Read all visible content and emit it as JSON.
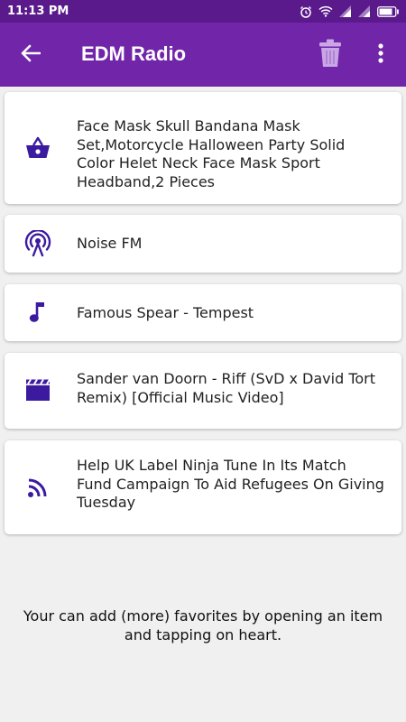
{
  "status_bar": {
    "time": "11:13 PM",
    "icons": [
      "alarm-icon",
      "wifi-icon",
      "signal-icon",
      "signal-icon",
      "battery-icon"
    ]
  },
  "app_bar": {
    "title": "EDM Radio",
    "back_icon": "arrow-left-icon",
    "trash_icon": "trash-icon",
    "menu_icon": "more-vert-icon"
  },
  "colors": {
    "status_bar": "#5a1a8c",
    "app_bar": "#7125a9",
    "icon_accent": "#3b1aa0",
    "background": "#f0f0f0"
  },
  "favorites": [
    {
      "icon": "shopping-basket-icon",
      "label": "Face Mask Skull Bandana Mask Set,Motorcycle Halloween Party Solid Color Helet Neck Face Mask Sport Headband,2 Pieces"
    },
    {
      "icon": "radio-tower-icon",
      "label": "Noise FM"
    },
    {
      "icon": "music-note-icon",
      "label": "Famous Spear - Tempest"
    },
    {
      "icon": "movie-clapper-icon",
      "label": "Sander van Doorn - Riff (SvD x David Tort Remix) [Official Music Video]"
    },
    {
      "icon": "rss-feed-icon",
      "label": "Help UK Label Ninja Tune In Its Match Fund Campaign To Aid Refugees On Giving Tuesday"
    }
  ],
  "footer_note": "Your can add (more) favorites by opening an item and tapping on heart."
}
